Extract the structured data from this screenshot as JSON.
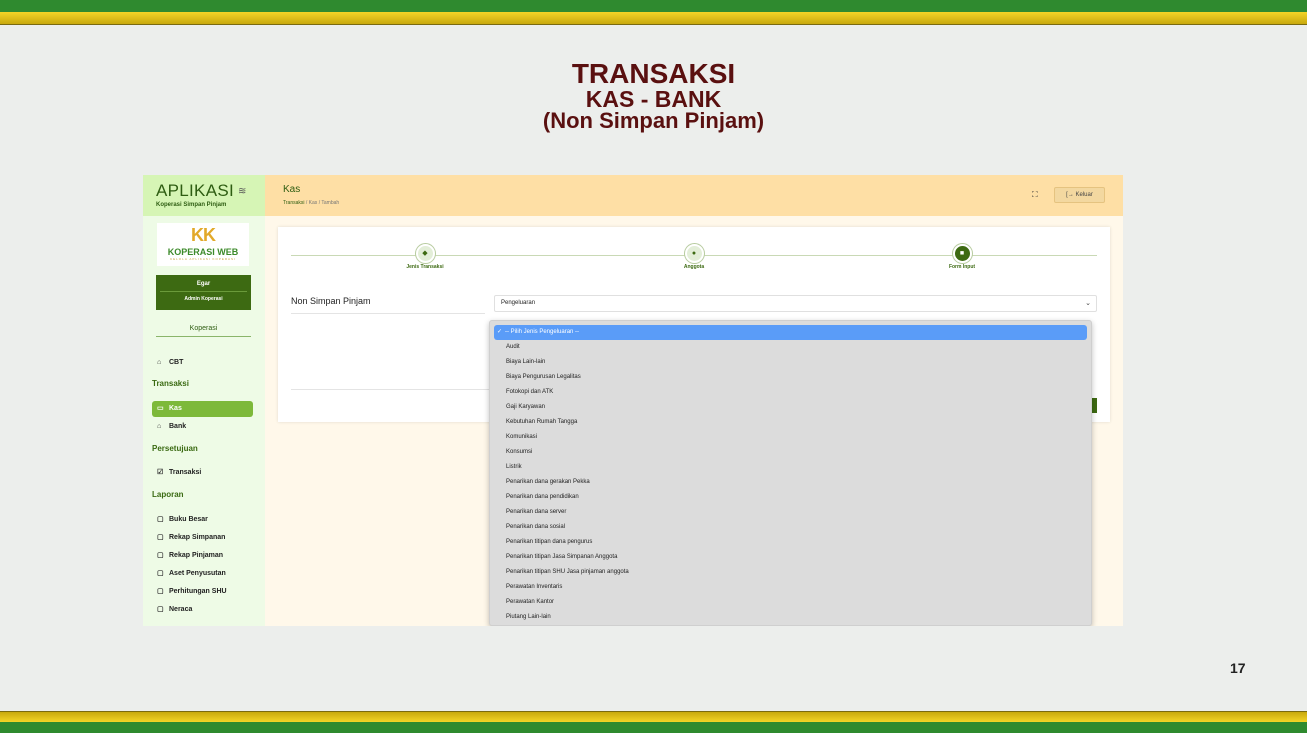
{
  "slide": {
    "title1": "TRANSAKSI",
    "title2": "KAS - BANK",
    "title3": "(Non Simpan Pinjam)",
    "page_number": "17"
  },
  "app": {
    "brand": {
      "name": "APLIKASI",
      "subtitle": "Koperasi Simpan Pinjam",
      "menu_icon": "≋"
    },
    "logo": {
      "mark": "KK",
      "text": "KOPERASI WEB",
      "tagline": "KELOLA APLIKASI KOPERASI"
    },
    "user": {
      "name": "Egar",
      "role": "Admin Koperasi"
    },
    "sidebar": {
      "section_label": "Koperasi",
      "cbt": "CBT",
      "head_transaksi": "Transaksi",
      "kas": "Kas",
      "bank": "Bank",
      "head_persetujuan": "Persetujuan",
      "transaksi": "Transaksi",
      "head_laporan": "Laporan",
      "laporan_items": [
        "Buku Besar",
        "Rekap Simpanan",
        "Rekap Pinjaman",
        "Aset Penyusutan",
        "Perhitungan SHU",
        "Neraca"
      ]
    },
    "topbar": {
      "title": "Kas",
      "breadcrumb": [
        "Transaksi",
        "Kas",
        "Tambah"
      ],
      "breadcrumb_sep": "/",
      "logout_label": "Keluar"
    },
    "steps": [
      {
        "label": "Jenis Transaksi",
        "icon": "◆"
      },
      {
        "label": "Anggota",
        "icon": "●"
      },
      {
        "label": "Form Input",
        "icon": "■"
      }
    ],
    "form": {
      "label": "Non Simpan Pinjam",
      "select_value": "Pengeluaran"
    },
    "dropdown": {
      "selected": "-- Pilih Jenis Pengeluaran --",
      "options": [
        "Audit",
        "Biaya Lain-lain",
        "Biaya Pengurusan Legalitas",
        "Fotokopi dan ATK",
        "Gaji Karyawan",
        "Kebutuhan Rumah Tangga",
        "Komunikasi",
        "Konsumsi",
        "Listrik",
        "Penarikan dana gerakan Pekka",
        "Penarikan dana pendidikan",
        "Penarikan dana server",
        "Penarikan dana sosial",
        "Penarikan titipan dana pengurus",
        "Penarikan titipan Jasa Simpanan Anggota",
        "Penarikan titipan SHU Jasa pinjaman anggota",
        "Perawatan Inventaris",
        "Perawatan Kantor",
        "Piutang Lain-lain"
      ]
    }
  }
}
